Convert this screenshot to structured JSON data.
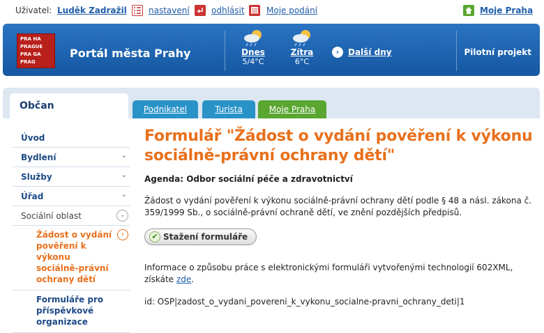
{
  "userbar": {
    "user_label": "Uživatel:",
    "user_name": "Luděk Zadražil",
    "settings": "nastavení",
    "logout": "odhlásit",
    "my_submissions": "Moje podání",
    "my_praha": "Moje Praha"
  },
  "header": {
    "logo_lines": [
      "PRA HA",
      "PRAGUE",
      "PRA GA",
      "PRAG"
    ],
    "portal_title": "Portál města Prahy",
    "weather": [
      {
        "day": "Dnes",
        "temp": "5/4°C",
        "icon": "partly-cloudy-rain-icon"
      },
      {
        "day": "Zítra",
        "temp": "6°C",
        "icon": "partly-cloudy-rain-icon"
      }
    ],
    "next_days": "Další dny",
    "pilot": "Pilotní projekt"
  },
  "tabs": {
    "active": "Občan",
    "others": [
      {
        "label": "Podnikatel",
        "color": "#2993c8"
      },
      {
        "label": "Turista",
        "color": "#2993c8"
      },
      {
        "label": "Moje Praha",
        "color": "#5aa631"
      }
    ]
  },
  "sidebar": {
    "items": [
      {
        "label": "Úvod"
      },
      {
        "label": "Bydlení"
      },
      {
        "label": "Služby"
      },
      {
        "label": "Úřad"
      },
      {
        "label": "Sociální oblast"
      }
    ],
    "sub_items": [
      {
        "label": "Žádost o vydání pověření k výkonu sociálně-právní ochrany dětí"
      },
      {
        "label": "Formuláře pro příspěvkové organizace"
      }
    ]
  },
  "main": {
    "title": "Formulář \"Žádost o vydání pověření k výkonu sociálně-právní ochrany dětí\"",
    "agenda": "Agenda: Odbor sociální péče a zdravotnictví",
    "description": "Žádost o vydání pověření k výkonu sociálně-právní ochrany dětí podle § 48 a násl. zákona č. 359/1999 Sb., o sociálně-právní ochraně dětí, ve znění pozdějších předpisů.",
    "download_label": "Stažení formuláře",
    "info_text": "Informace o způsobu práce s elektronickými formuláři vytvořenými technologií 602XML, získáte",
    "info_link": "zde",
    "info_end": ".",
    "identifier": "id: OSP|zadost_o_vydani_povereni_k_vykonu_socialne-pravni_ochrany_deti|1"
  },
  "colors": {
    "header_blue": "#1c62ae",
    "accent_orange": "#e8701c",
    "link_blue": "#1f5da8",
    "tab_green": "#5aa631"
  }
}
